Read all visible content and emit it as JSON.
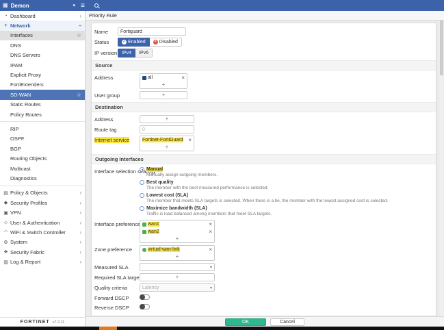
{
  "ui": {
    "add": "+",
    "remove": "×",
    "caret": "▾",
    "star": "☆",
    "chev": "›",
    "hamburger": "≡",
    "grid": "▦",
    "check": "✓",
    "x": "×"
  },
  "colors": {
    "accent_blue": "#3c63aa",
    "highlight_yellow": "#fbe53b",
    "ok_green": "#2eb890",
    "disabled_red": "#d9534f",
    "member_green": "#4caf50"
  },
  "topbar": {
    "vdom": "Demon"
  },
  "page": {
    "title": "Priority Rule"
  },
  "sidebar": {
    "items_top": [
      {
        "label": "Dashboard"
      },
      {
        "label": "Network"
      }
    ],
    "network_children": [
      "Interfaces",
      "DNS",
      "DNS Servers",
      "IPAM",
      "Explicit Proxy",
      "FortiExtenders",
      "SD-WAN",
      "Static Routes",
      "Policy Routes",
      "RIP",
      "OSPF",
      "BGP",
      "Routing Objects",
      "Multicast",
      "Diagnostics"
    ],
    "items_bottom": [
      "Policy & Objects",
      "Security Profiles",
      "VPN",
      "User & Authentication",
      "WiFi & Switch Controller",
      "System",
      "Security Fabric",
      "Log & Report"
    ],
    "brand": "FORTINET",
    "version": "v7.2.11"
  },
  "form": {
    "name": {
      "label": "Name",
      "value": "Fortiguard"
    },
    "status": {
      "label": "Status",
      "enabled": "Enabled",
      "disabled": "Disabled",
      "selected": "Enabled"
    },
    "ip_version": {
      "label": "IP version",
      "ipv4": "IPv4",
      "ipv6": "IPv6",
      "selected": "IPv4"
    },
    "source": {
      "title": "Source",
      "address_label": "Address",
      "address_entries": [
        "all"
      ],
      "user_group_label": "User group"
    },
    "destination": {
      "title": "Destination",
      "address_label": "Address",
      "route_tag_label": "Route tag",
      "route_tag_placeholder": "0",
      "internet_service_label": "Internet service",
      "internet_service_entries": [
        "Fortinet-FortiGuard"
      ]
    },
    "outgoing": {
      "title": "Outgoing Interfaces",
      "strategy_label": "Interface selection strategy",
      "strategies": [
        {
          "label": "Manual",
          "desc": "Manually assign outgoing members.",
          "selected": true
        },
        {
          "label": "Best quality",
          "desc": "The member with the best measured performance is selected.",
          "selected": false
        },
        {
          "label": "Lowest cost (SLA)",
          "desc": "The member that meets SLA targets is selected. When there is a tie, the member with the lowest assigned cost is selected.",
          "selected": false
        },
        {
          "label": "Maximize bandwidth (SLA)",
          "desc": "Traffic is load balanced among members that meet SLA targets.",
          "selected": false
        }
      ],
      "interface_preference": {
        "label": "Interface preference",
        "entries": [
          "wan1",
          "wan2"
        ]
      },
      "zone_preference": {
        "label": "Zone preference",
        "entries": [
          "virtual-wan-link"
        ]
      },
      "measured_sla_label": "Measured SLA",
      "required_sla_label": "Required SLA target",
      "quality_criteria": {
        "label": "Quality criteria",
        "value": "Latency"
      },
      "forward_dscp_label": "Forward DSCP",
      "reverse_dscp_label": "Reverse DSCP"
    },
    "footer": {
      "ok": "OK",
      "cancel": "Cancel"
    }
  }
}
